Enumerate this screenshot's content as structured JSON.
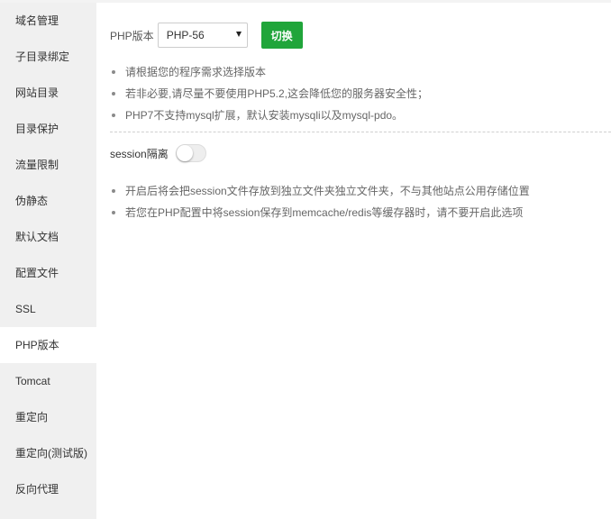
{
  "sidebar": {
    "items": [
      {
        "label": "域名管理",
        "active": false
      },
      {
        "label": "子目录绑定",
        "active": false
      },
      {
        "label": "网站目录",
        "active": false
      },
      {
        "label": "目录保护",
        "active": false
      },
      {
        "label": "流量限制",
        "active": false
      },
      {
        "label": "伪静态",
        "active": false
      },
      {
        "label": "默认文档",
        "active": false
      },
      {
        "label": "配置文件",
        "active": false
      },
      {
        "label": "SSL",
        "active": false
      },
      {
        "label": "PHP版本",
        "active": true
      },
      {
        "label": "Tomcat",
        "active": false
      },
      {
        "label": "重定向",
        "active": false
      },
      {
        "label": "重定向(测试版)",
        "active": false
      },
      {
        "label": "反向代理",
        "active": false
      }
    ]
  },
  "php": {
    "label": "PHP版本",
    "selected_version": "PHP-56",
    "switch_label": "切换",
    "tips": [
      "请根据您的程序需求选择版本",
      "若非必要,请尽量不要使用PHP5.2,这会降低您的服务器安全性；",
      "PHP7不支持mysql扩展，默认安装mysqli以及mysql-pdo。"
    ]
  },
  "session": {
    "label": "session隔离",
    "enabled": false,
    "tips": [
      "开启后将会把session文件存放到独立文件夹独立文件夹，不与其他站点公用存储位置",
      "若您在PHP配置中将session保存到memcache/redis等缓存器时，请不要开启此选项"
    ]
  },
  "colors": {
    "accent": "#20a53a",
    "sidebar_bg": "#f0f0f0",
    "active_bg": "#ffffff"
  }
}
